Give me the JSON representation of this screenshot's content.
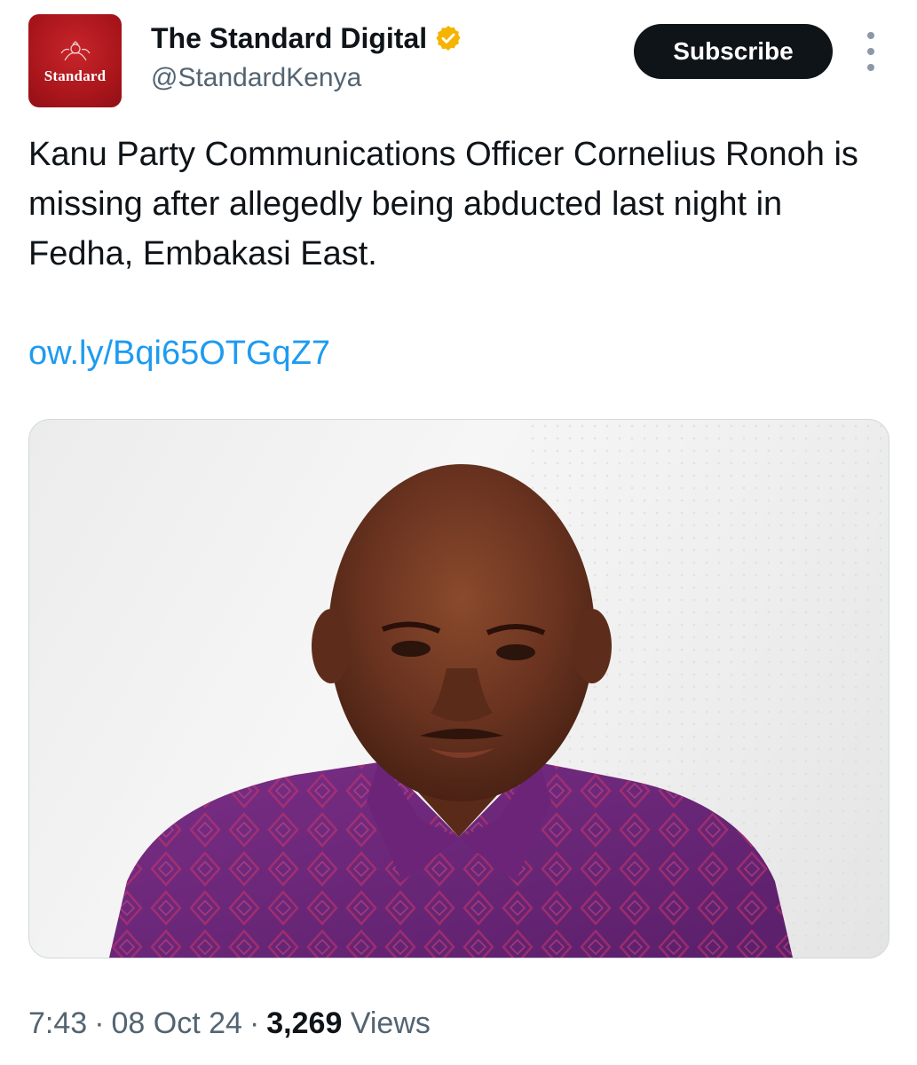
{
  "account": {
    "display_name": "The Standard Digital",
    "handle": "@StandardKenya",
    "avatar_text": "Standard",
    "verified": true,
    "verified_color": "#f4b400"
  },
  "actions": {
    "subscribe_label": "Subscribe"
  },
  "tweet": {
    "text": "Kanu Party Communications Officer Cornelius Ronoh is missing after allegedly being abducted last night in Fedha, Embakasi East.",
    "link": "ow.ly/Bqi65OTGqZ7"
  },
  "meta": {
    "time": "7:43",
    "date": "08 Oct 24",
    "views_count": "3,269",
    "views_label": "Views"
  },
  "colors": {
    "brand_red": "#a5141a",
    "link_blue": "#1d9bf0",
    "text_primary": "#0f1419",
    "text_secondary": "#536471",
    "shirt_purple": "#6a2a7a"
  },
  "icons": {
    "verified": "verified-badge-icon",
    "more": "more-vertical-icon"
  }
}
